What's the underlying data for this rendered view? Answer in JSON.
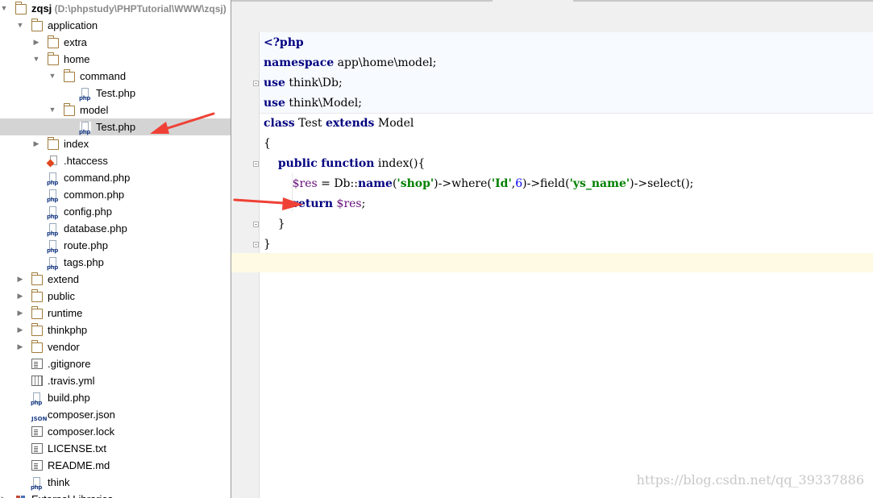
{
  "project_tree": {
    "rows": [
      {
        "label": "zqsj",
        "hint": " (D:\\phpstudy\\PHPTutorial\\WWW\\zqsj)",
        "icon": "folder-icon",
        "level": 0,
        "expanded": true,
        "bold": true
      },
      {
        "label": "application",
        "icon": "folder-icon",
        "level": 1,
        "expanded": true
      },
      {
        "label": "extra",
        "icon": "folder-icon",
        "level": 2,
        "expanded": false
      },
      {
        "label": "home",
        "icon": "folder-icon",
        "level": 2,
        "expanded": true
      },
      {
        "label": "command",
        "icon": "folder-icon",
        "level": 3,
        "expanded": true
      },
      {
        "label": "Test.php",
        "icon": "php-file-icon",
        "level": 4
      },
      {
        "label": "model",
        "icon": "folder-icon",
        "level": 3,
        "expanded": true
      },
      {
        "label": "Test.php",
        "icon": "php-file-icon",
        "level": 4,
        "selected": true
      },
      {
        "label": "index",
        "icon": "folder-icon",
        "level": 2,
        "expanded": false
      },
      {
        "label": ".htaccess",
        "icon": "htaccess-file-icon",
        "level": 2
      },
      {
        "label": "command.php",
        "icon": "php-file-icon",
        "level": 2
      },
      {
        "label": "common.php",
        "icon": "php-file-icon",
        "level": 2
      },
      {
        "label": "config.php",
        "icon": "php-file-icon",
        "level": 2
      },
      {
        "label": "database.php",
        "icon": "php-file-icon",
        "level": 2
      },
      {
        "label": "route.php",
        "icon": "php-file-icon",
        "level": 2
      },
      {
        "label": "tags.php",
        "icon": "php-file-icon",
        "level": 2
      },
      {
        "label": "extend",
        "icon": "folder-icon",
        "level": 1,
        "expanded": false
      },
      {
        "label": "public",
        "icon": "folder-icon",
        "level": 1,
        "expanded": false
      },
      {
        "label": "runtime",
        "icon": "folder-icon",
        "level": 1,
        "expanded": false
      },
      {
        "label": "thinkphp",
        "icon": "folder-icon",
        "level": 1,
        "expanded": false
      },
      {
        "label": "vendor",
        "icon": "folder-icon",
        "level": 1,
        "expanded": false
      },
      {
        "label": ".gitignore",
        "icon": "text-file-icon",
        "level": 1
      },
      {
        "label": ".travis.yml",
        "icon": "yml-file-icon",
        "level": 1
      },
      {
        "label": "build.php",
        "icon": "php-file-icon",
        "level": 1
      },
      {
        "label": "composer.json",
        "icon": "json-file-icon",
        "level": 1
      },
      {
        "label": "composer.lock",
        "icon": "text-file-icon",
        "level": 1
      },
      {
        "label": "LICENSE.txt",
        "icon": "text-file-icon",
        "level": 1
      },
      {
        "label": "README.md",
        "icon": "text-file-icon",
        "level": 1
      },
      {
        "label": "think",
        "icon": "php-file-icon",
        "level": 1
      },
      {
        "label": "External Libraries",
        "icon": "external-libraries-icon",
        "level": 0,
        "expanded": false
      }
    ]
  },
  "editor": {
    "lines": [
      [
        {
          "t": "<?php",
          "c": "kw"
        }
      ],
      [
        {
          "t": "namespace",
          "c": "kw"
        },
        {
          "t": " app\\home\\model;"
        }
      ],
      [
        {
          "t": "use",
          "c": "kw"
        },
        {
          "t": " think\\Db;"
        }
      ],
      [
        {
          "t": "use",
          "c": "kw"
        },
        {
          "t": " think\\Model;"
        }
      ],
      [
        {
          "t": "class",
          "c": "kw"
        },
        {
          "t": " Test "
        },
        {
          "t": "extends",
          "c": "kw"
        },
        {
          "t": " Model"
        }
      ],
      [
        {
          "t": "{"
        }
      ],
      [
        {
          "t": "    "
        },
        {
          "t": "public",
          "c": "kw"
        },
        {
          "t": " "
        },
        {
          "t": "function",
          "c": "kw"
        },
        {
          "t": " index(){"
        }
      ],
      [
        {
          "t": "        "
        },
        {
          "t": "$res",
          "c": "var"
        },
        {
          "t": " = Db::"
        },
        {
          "t": "name",
          "c": "fn"
        },
        {
          "t": "("
        },
        {
          "t": "'shop'",
          "c": "str"
        },
        {
          "t": ")->where("
        },
        {
          "t": "'Id'",
          "c": "str"
        },
        {
          "t": ","
        },
        {
          "t": "6",
          "c": "num"
        },
        {
          "t": ")->field("
        },
        {
          "t": "'ys_name'",
          "c": "str"
        },
        {
          "t": ")->select();"
        }
      ],
      [
        {
          "t": "        "
        },
        {
          "t": "return",
          "c": "kw"
        },
        {
          "t": " "
        },
        {
          "t": "$res",
          "c": "var"
        },
        {
          "t": ";"
        }
      ],
      [
        {
          "t": "    }"
        }
      ],
      [
        {
          "t": "}"
        }
      ]
    ]
  },
  "watermark": "https://blog.csdn.net/qq_39337886",
  "colors": {
    "keyword": "#000080",
    "string": "#008000",
    "variable": "#660e7a",
    "number": "#0000ff",
    "annotation_arrow": "#ef4136",
    "selection": "#d4d4d4"
  }
}
